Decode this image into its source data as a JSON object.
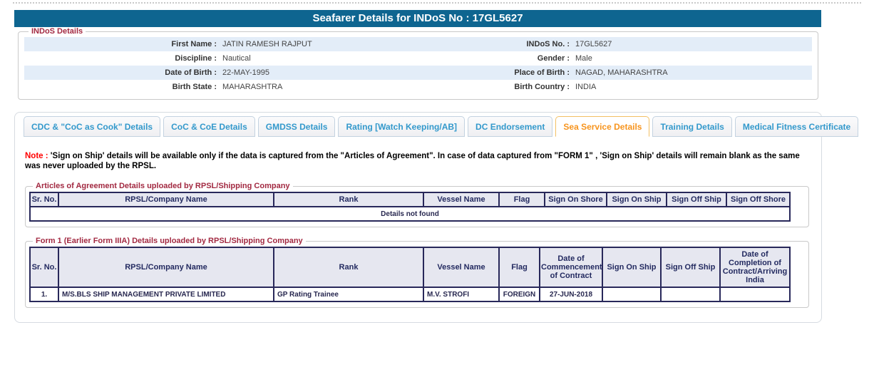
{
  "page": {
    "title": "Seafarer Details for INDoS No : 17GL5627"
  },
  "colors": {
    "title_bar_bg": "#0e6590",
    "legend_maroon": "#a22941",
    "tab_text_blue": "#3399cc",
    "active_tab_orange": "#f7941d",
    "active_tab_border": "#f3c064",
    "table_border_navy": "#28285a",
    "table_header_bg": "#e6e7f0",
    "row_alt_blue": "#e3edf8",
    "note_red": "#ff0000",
    "details_not_found_red": "#d80000"
  },
  "indos_details": {
    "legend": "INDoS Details",
    "rows": [
      {
        "label1": "First Name :",
        "value1": "JATIN RAMESH RAJPUT",
        "label2": "INDoS No. :",
        "value2": "17GL5627"
      },
      {
        "label1": "Discipline :",
        "value1": "Nautical",
        "label2": "Gender :",
        "value2": "Male"
      },
      {
        "label1": "Date of Birth :",
        "value1": "22-MAY-1995",
        "label2": "Place of Birth :",
        "value2": "NAGAD, MAHARASHTRA"
      },
      {
        "label1": "Birth State :",
        "value1": "MAHARASHTRA",
        "label2": "Birth Country :",
        "value2": "INDIA"
      }
    ]
  },
  "tabs": [
    {
      "label": "CDC & \"CoC as Cook\" Details",
      "active": false
    },
    {
      "label": "CoC & CoE Details",
      "active": false
    },
    {
      "label": "GMDSS Details",
      "active": false
    },
    {
      "label": "Rating [Watch Keeping/AB]",
      "active": false
    },
    {
      "label": "DC Endorsement",
      "active": false
    },
    {
      "label": "Sea Service Details",
      "active": true
    },
    {
      "label": "Training Details",
      "active": false
    },
    {
      "label": "Medical Fitness Certificate",
      "active": false
    }
  ],
  "note": {
    "prefix": "Note :",
    "text": " 'Sign on Ship' details will be available only if the data is captured from the \"Articles of Agreement\". In case of data captured from \"FORM 1\" , 'Sign on Ship' details will remain blank as the same was never uploaded by the RPSL."
  },
  "articles_table": {
    "legend": "Articles of Agreement Details uploaded by RPSL/Shipping Company",
    "headers": [
      "Sr. No.",
      "RPSL/Company Name",
      "Rank",
      "Vessel Name",
      "Flag",
      "Sign On Shore",
      "Sign On Ship",
      "Sign Off Ship",
      "Sign Off Shore"
    ],
    "empty_message": "Details not found"
  },
  "form1_table": {
    "legend": "Form 1 (Earlier Form IIIA) Details uploaded by RPSL/Shipping Company",
    "headers": [
      "Sr. No.",
      "RPSL/Company Name",
      "Rank",
      "Vessel Name",
      "Flag",
      "Date of Commencement of Contract",
      "Sign On Ship",
      "Sign Off Ship",
      "Date of Completion of Contract/Arriving India"
    ],
    "rows": [
      [
        "1.",
        "M/S.BLS SHIP MANAGEMENT PRIVATE LIMITED",
        "GP Rating Trainee",
        "M.V. STROFI",
        "FOREIGN",
        "27-JUN-2018",
        "",
        "",
        ""
      ]
    ]
  }
}
